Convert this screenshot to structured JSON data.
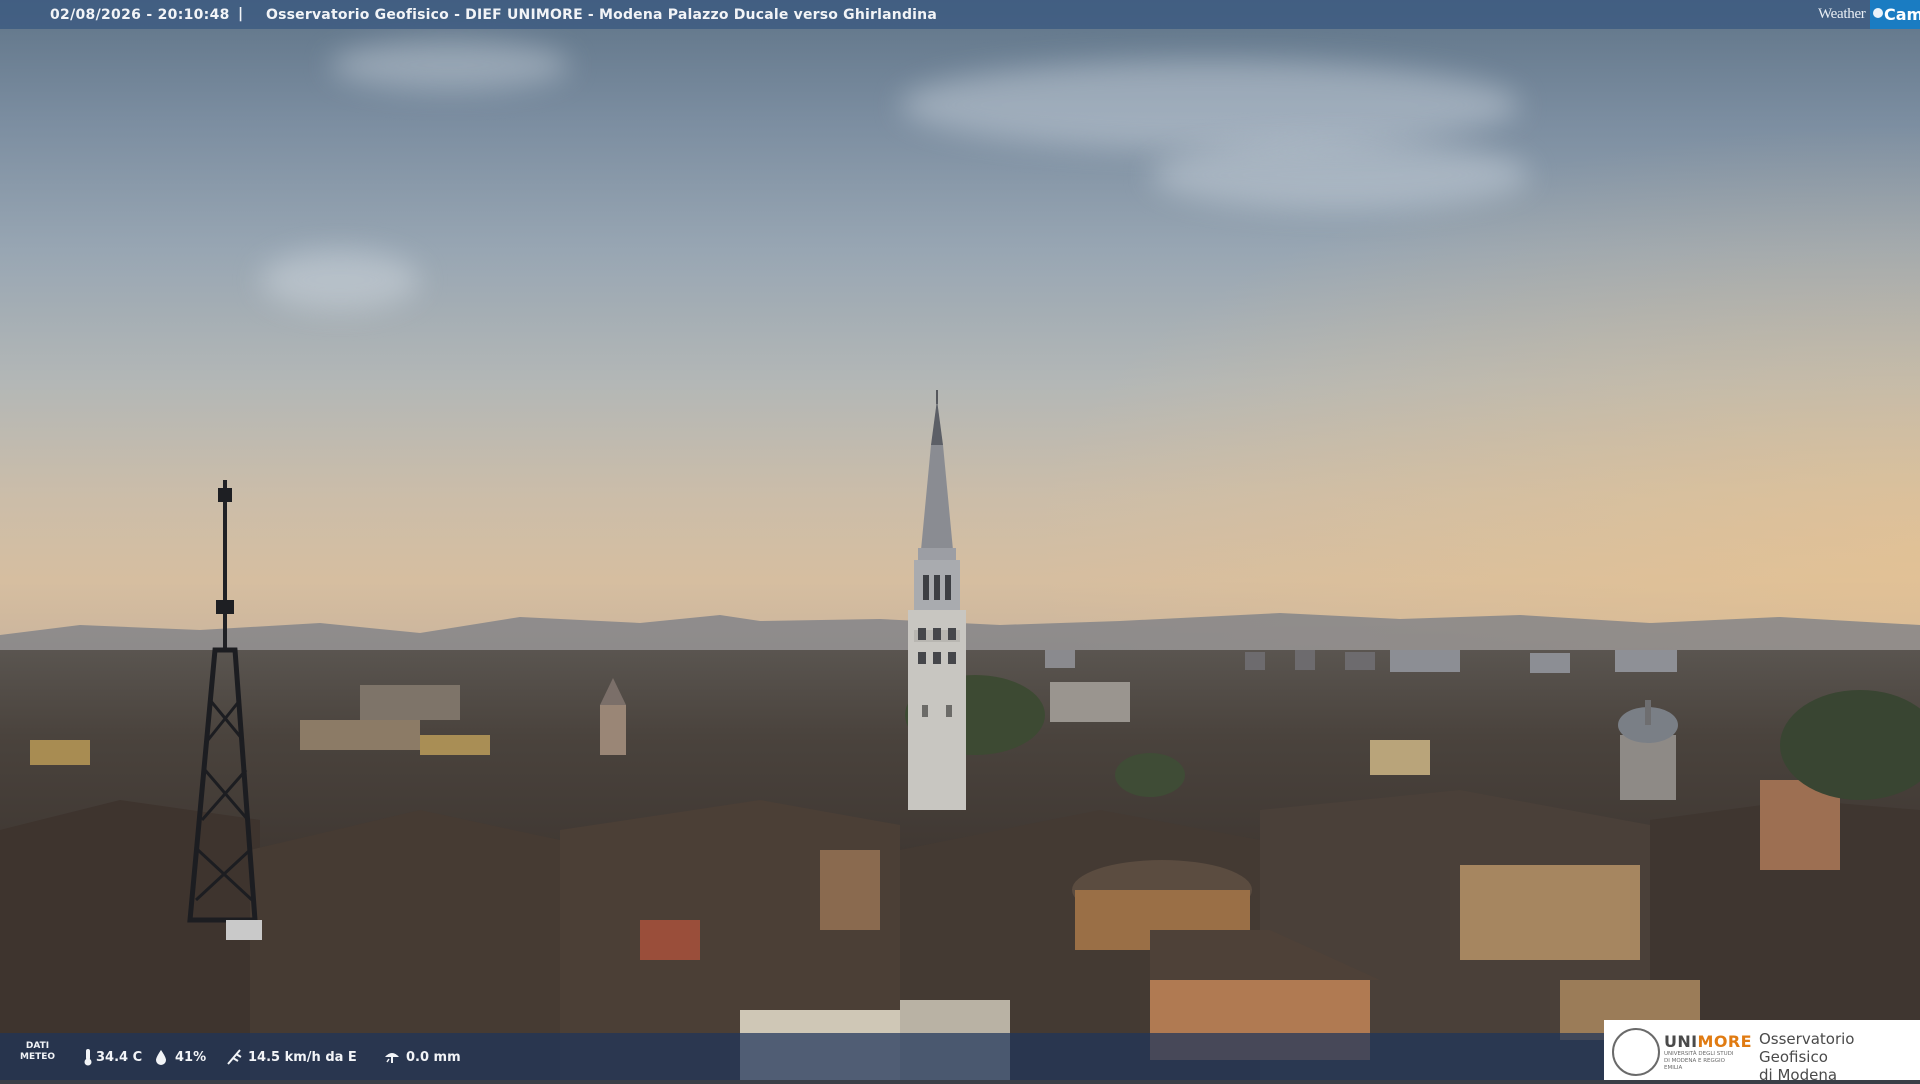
{
  "header": {
    "timestamp": "02/08/2026 - 20:10:48",
    "separator": "|",
    "title": "Osservatorio Geofisico - DIEF UNIMORE - Modena Palazzo Ducale verso Ghirlandina"
  },
  "brand": {
    "weather": "Weather",
    "cam": "Cam"
  },
  "weather_bar": {
    "label": "DATI\nMETEO",
    "temperature": "34.4 C",
    "humidity": "41%",
    "wind": "14.5 km/h da E",
    "rain": "0.0 mm"
  },
  "logo": {
    "university": "UNIMORE",
    "university_sub": "UNIVERSITÀ DEGLI STUDI DI MODENA E REGGIO EMILIA",
    "observatory": "Osservatorio Geofisico\ndi Modena"
  },
  "colors": {
    "header_bg": "#3a5880",
    "brand_cam_bg": "#1a7cc2",
    "accent_orange": "#e07b12"
  }
}
